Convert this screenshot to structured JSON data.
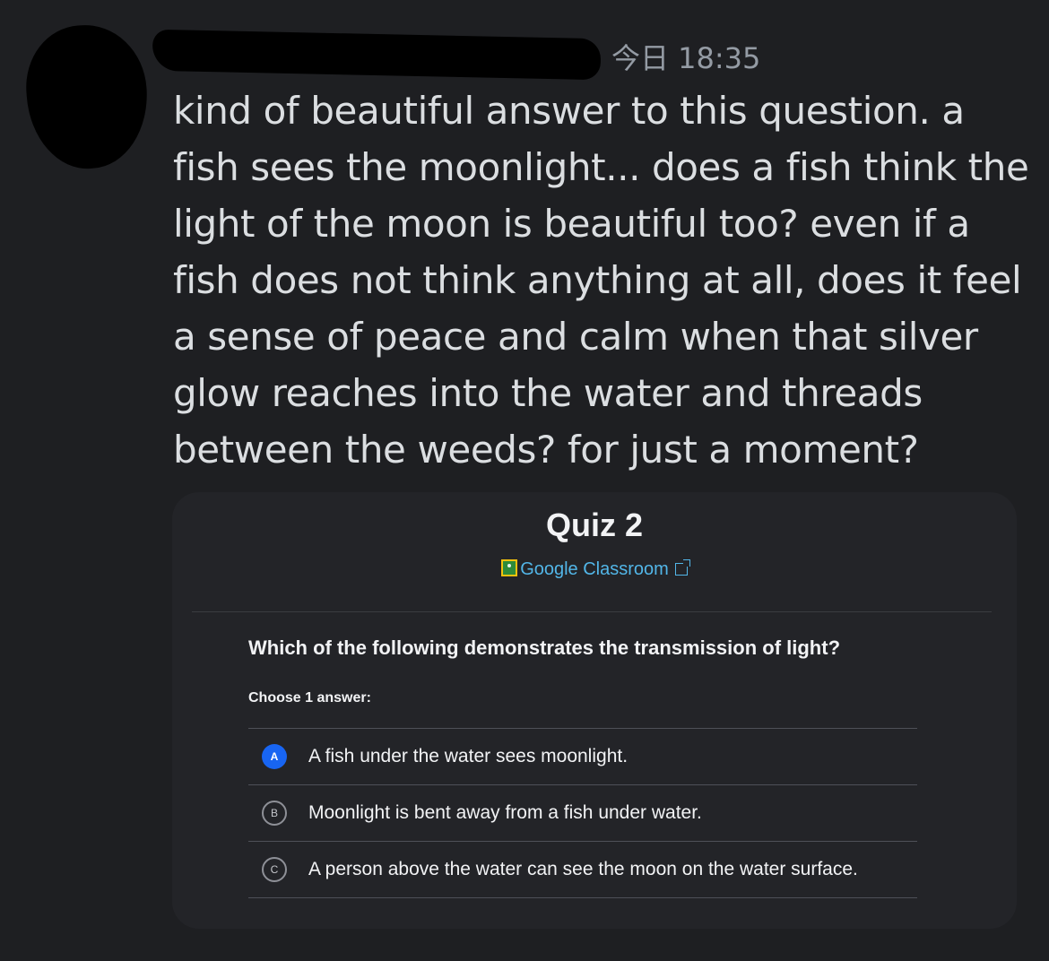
{
  "message": {
    "author": "",
    "timestamp": "今日 18:35",
    "text": "kind of beautiful answer to this question. a fish sees the moonlight... does a fish think the light of the moon is beautiful too? even if a fish does not think anything at all, does it feel a sense of peace and calm when that silver glow reaches into the water and threads between the weeds? for just a moment?"
  },
  "embed": {
    "title": "Quiz 2",
    "provider": "Google Classroom",
    "provider_icon": "google-classroom-icon",
    "link_icon": "external-link-icon",
    "question": "Which of the following demonstrates the transmission of light?",
    "instruction": "Choose 1 answer:",
    "options": [
      {
        "letter": "A",
        "text": "A fish under the water sees moonlight.",
        "selected": true
      },
      {
        "letter": "B",
        "text": "Moonlight is bent away from a fish under water.",
        "selected": false
      },
      {
        "letter": "C",
        "text": "A person above the water can see the moon on the water surface.",
        "selected": false
      }
    ]
  },
  "colors": {
    "background": "#1e1f22",
    "card": "#232428",
    "link": "#52b6e8",
    "selected_choice": "#1865f2"
  }
}
